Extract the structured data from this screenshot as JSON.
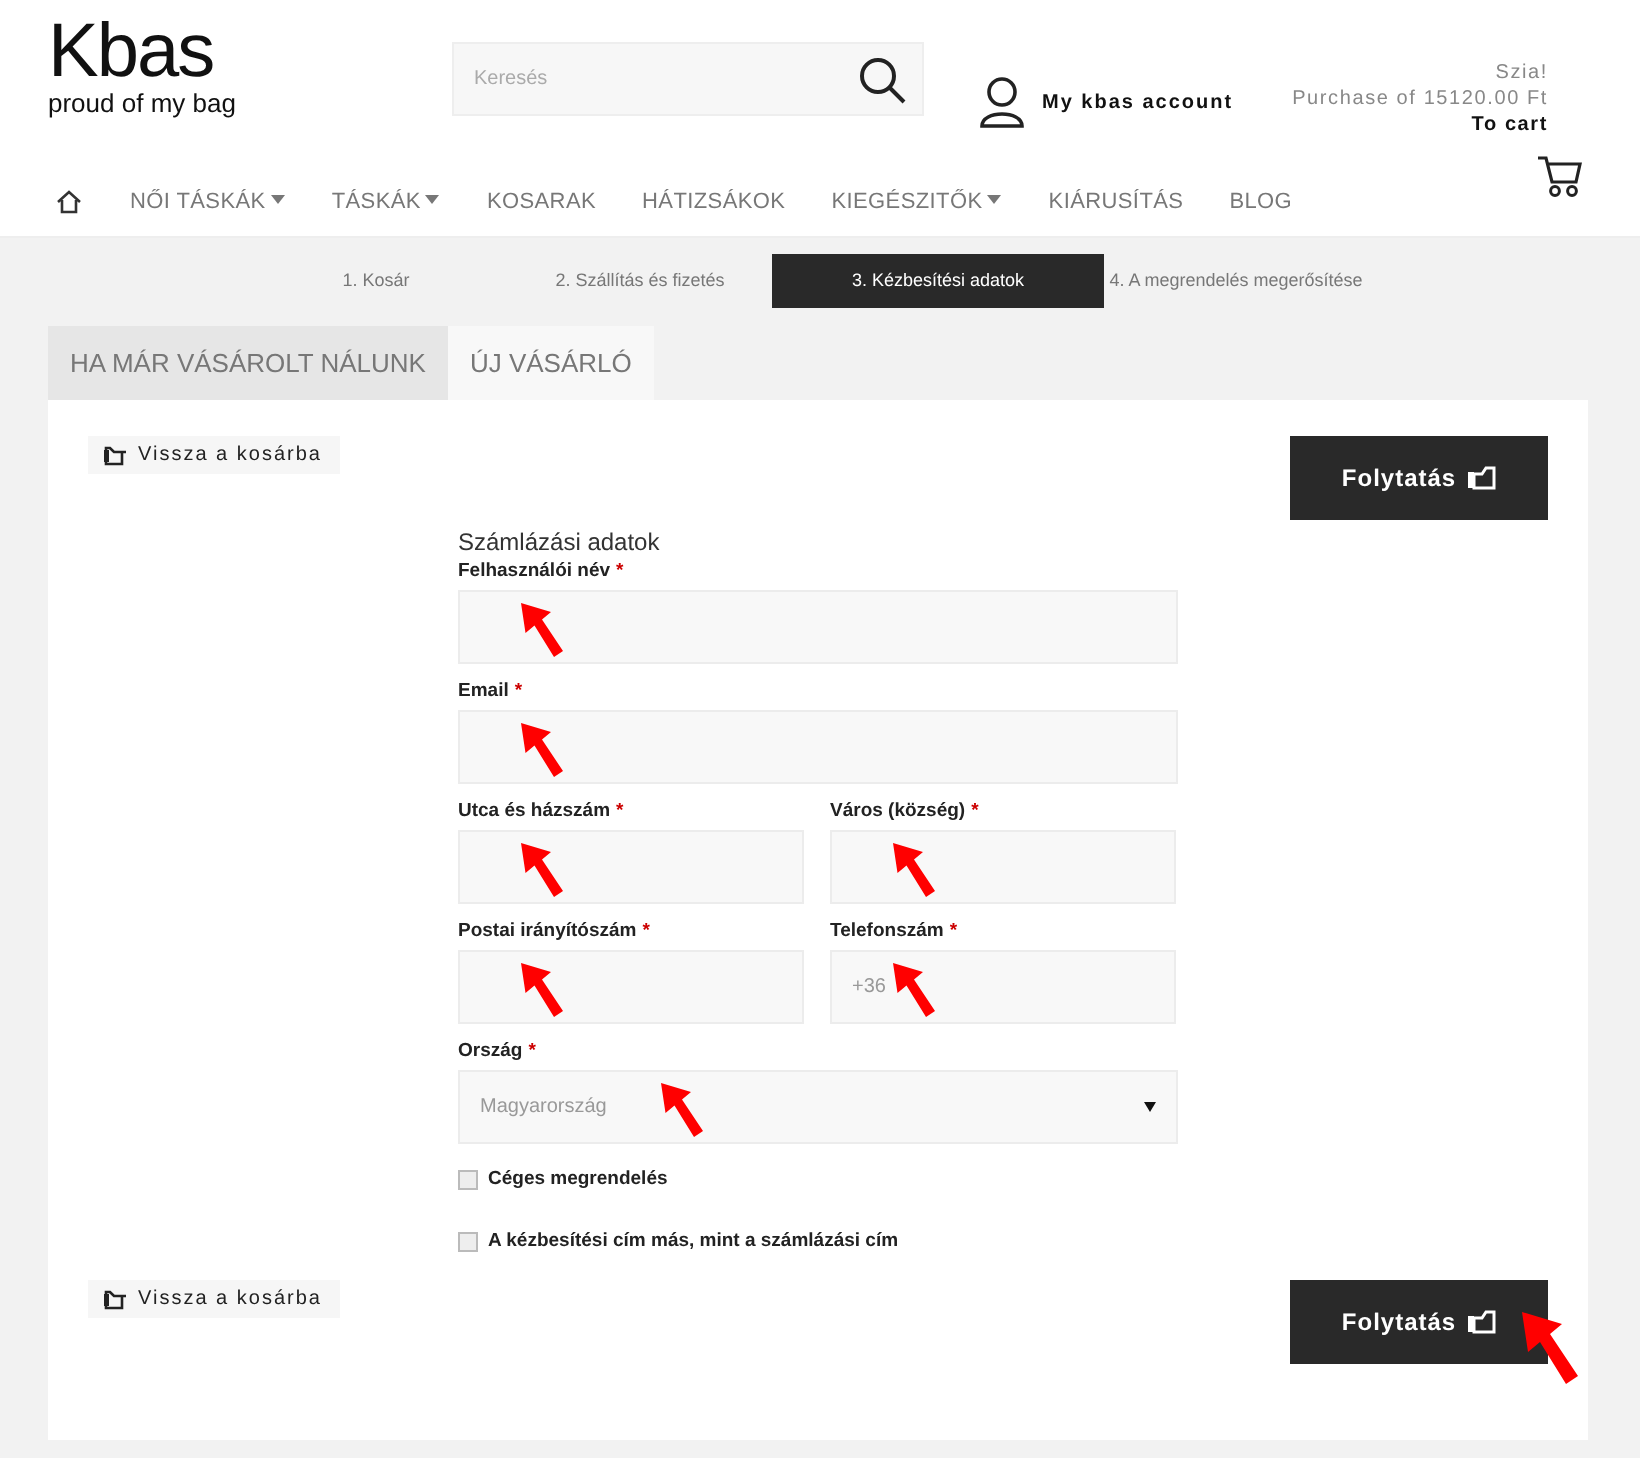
{
  "logo": {
    "wordmark": "Kbas",
    "tagline": "proud of my bag"
  },
  "search": {
    "placeholder": "Keresés"
  },
  "account": {
    "label": "My kbas account"
  },
  "cart": {
    "greeting": "Szia!",
    "summary": "Purchase of 15120.00 Ft",
    "link": "To cart"
  },
  "nav": [
    {
      "kind": "home"
    },
    {
      "kind": "link",
      "label": "NŐI TÁSKÁK",
      "dropdown": true
    },
    {
      "kind": "link",
      "label": "TÁSKÁK",
      "dropdown": true
    },
    {
      "kind": "link",
      "label": "KOSARAK",
      "dropdown": false
    },
    {
      "kind": "link",
      "label": "HÁTIZSÁKOK",
      "dropdown": false
    },
    {
      "kind": "link",
      "label": "KIEGÉSZITŐK",
      "dropdown": true
    },
    {
      "kind": "link",
      "label": "KIÁRUSÍTÁS",
      "dropdown": false
    },
    {
      "kind": "link",
      "label": "BLOG",
      "dropdown": false
    }
  ],
  "steps": [
    {
      "label": "1. Kosár",
      "selected": false
    },
    {
      "label": "2. Szállítás és fizetés",
      "selected": false
    },
    {
      "label": "3. Kézbesítési adatok",
      "selected": true
    },
    {
      "label": "4. A megrendelés megerősítése",
      "selected": false
    }
  ],
  "tabs": [
    {
      "label": "HA MÁR VÁSÁROLT NÁLUNK",
      "selected": false
    },
    {
      "label": "ÚJ VÁSÁRLÓ",
      "selected": true
    }
  ],
  "top_actions": {
    "back": "Vissza a kosárba",
    "continue": "Folytatás",
    "arrow": false
  },
  "form": {
    "title": "Számlázási adatok",
    "fields": [
      {
        "kind": "text",
        "label": "Felhasználói név",
        "required_mark": "*",
        "half": false,
        "arrow": true
      },
      {
        "kind": "text",
        "label": "Email",
        "required_mark": "*",
        "half": false,
        "arrow": true
      },
      {
        "kind": "text",
        "label": "Utca és házszám",
        "required_mark": "*",
        "half": true,
        "arrow": true
      },
      {
        "kind": "text",
        "label": "Város (község)",
        "required_mark": "*",
        "half": true,
        "arrow": true
      },
      {
        "kind": "text",
        "label": "Postai irányítószám",
        "required_mark": "*",
        "half": true,
        "arrow": true
      },
      {
        "kind": "text",
        "label": "Telefonszám",
        "required_mark": "*",
        "half": true,
        "arrow": true,
        "placeholder": "+36"
      },
      {
        "kind": "select",
        "label": "Ország",
        "required_mark": "*",
        "half": false,
        "arrow": true,
        "value": "Magyarország"
      }
    ],
    "checkboxes": [
      {
        "label": "Céges megrendelés",
        "checked": false
      },
      {
        "label": "A kézbesítési cím más, mint a számlázási cím",
        "checked": false
      }
    ]
  },
  "bottom_actions": {
    "back": "Vissza a kosárba",
    "continue": "Folytatás",
    "arrow": true
  }
}
